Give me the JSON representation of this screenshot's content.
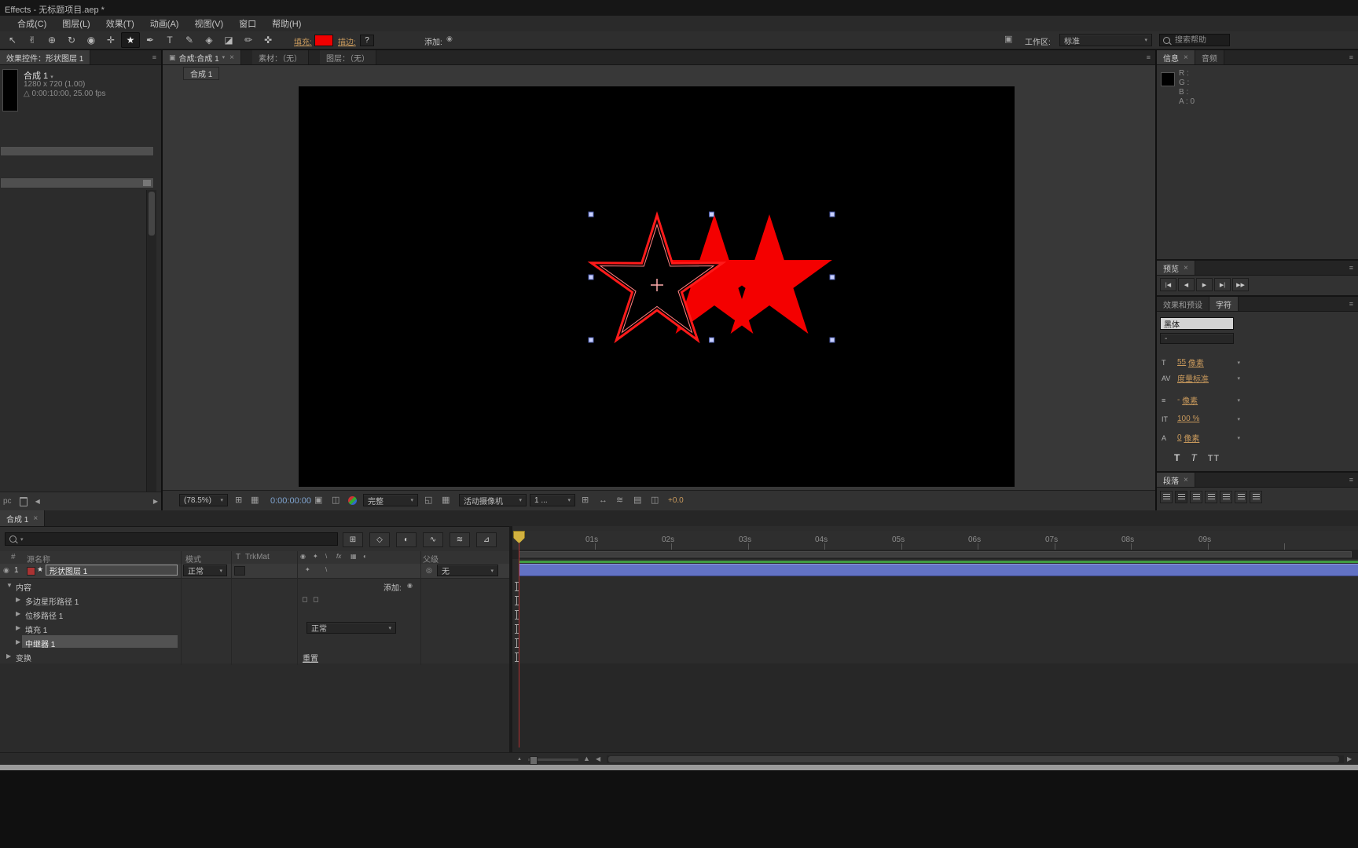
{
  "window": {
    "title": "Effects - 无标题项目.aep *"
  },
  "menu": {
    "items": [
      "合成(C)",
      "图层(L)",
      "效果(T)",
      "动画(A)",
      "视图(V)",
      "窗口",
      "帮助(H)"
    ]
  },
  "toolbar": {
    "tools": [
      {
        "name": "selection",
        "glyph": "↖"
      },
      {
        "name": "hand",
        "glyph": "✌"
      },
      {
        "name": "zoom",
        "glyph": "⊕"
      },
      {
        "name": "rotation",
        "glyph": "↻"
      },
      {
        "name": "camera",
        "glyph": "◉"
      },
      {
        "name": "pan-behind",
        "glyph": "✛"
      },
      {
        "name": "shape",
        "glyph": "★"
      },
      {
        "name": "pen",
        "glyph": "✒"
      },
      {
        "name": "text",
        "glyph": "T"
      },
      {
        "name": "brush",
        "glyph": "✎"
      },
      {
        "name": "clone-stamp",
        "glyph": "◈"
      },
      {
        "name": "eraser",
        "glyph": "◪"
      },
      {
        "name": "roto-brush",
        "glyph": "✏"
      },
      {
        "name": "puppet",
        "glyph": "✜"
      }
    ],
    "fill_label": "填充:",
    "stroke_label": "描边:",
    "stroke_value": "?",
    "add_label": "添加:",
    "workspace_label": "工作区:",
    "workspace_value": "标准",
    "search_placeholder": "搜索帮助",
    "fill_color": "#f00000"
  },
  "project_panel": {
    "tab_title": "效果控件：形状图层 1",
    "comp_name": "合成 1",
    "comp_dimensions": "1280 x 720 (1.00)",
    "comp_duration": "0:00:10:00, 25.00 fps",
    "bit_depth": "pc"
  },
  "viewer": {
    "tab_composition": "合成:合成 1",
    "tab_footage": "素材：（无）",
    "tab_layer": "图层：（无）",
    "comp_chip": "合成 1",
    "zoom_value": "(78.5%)",
    "timecode": "0:00:00:00",
    "resolution": "完整",
    "view_name": "活动摄像机",
    "view_count": "1 ...",
    "exposure": "+0.0"
  },
  "info": {
    "tab": "信息",
    "audio_tab": "音频",
    "r_label": "R :",
    "g_label": "G :",
    "b_label": "B :",
    "a_label": "A : 0"
  },
  "preview": {
    "tab": "预览"
  },
  "effects_presets": {
    "tab": "效果和预设"
  },
  "character": {
    "tab": "字符",
    "font_family": "黑体",
    "font_style": "-",
    "rows": [
      {
        "name": "font-size",
        "icon": "T",
        "value": "55",
        "unit": "像素"
      },
      {
        "name": "kerning",
        "icon": "AV",
        "value": "度量标准",
        "unit": ""
      },
      {
        "name": "tracking",
        "icon": "≡",
        "value": "-",
        "unit": "像素"
      },
      {
        "name": "vertical-scale",
        "icon": "IT",
        "value": "100 %",
        "unit": ""
      },
      {
        "name": "baseline-shift",
        "icon": "A",
        "value": "0",
        "unit": "像素"
      }
    ],
    "style_buttons": [
      "T",
      "T",
      "TT"
    ]
  },
  "paragraph": {
    "tab": "段落"
  },
  "timeline": {
    "tab": "合成 1",
    "search_placeholder": "",
    "header": {
      "hash": "#",
      "source_name": "源名称",
      "mode": "模式",
      "t": "T",
      "trkmat": "TrkMat",
      "parent": "父级"
    },
    "layer": {
      "index": "1",
      "name": "形状图层 1",
      "mode": "正常",
      "parent": "无"
    },
    "add_label": "添加:",
    "rows": [
      {
        "label": "内容"
      },
      {
        "label": "多边星形路径 1"
      },
      {
        "label": "位移路径 1"
      },
      {
        "label": "填充 1",
        "mode": "正常"
      },
      {
        "label": "中继器 1"
      },
      {
        "label": "变换",
        "reset": "重置"
      }
    ],
    "ruler_labels": [
      "01s",
      "02s",
      "03s",
      "04s",
      "05s",
      "06s",
      "07s",
      "08s",
      "09s"
    ]
  },
  "icons": {
    "panel_menu": "≡",
    "close": "×",
    "caret_down": "▾",
    "panel_tab": "▣",
    "warning_triangle": "△",
    "grid": "⊞",
    "mask_grid": "▦",
    "snapshot": "▣",
    "show_snapshot": "◫",
    "roi": "◱",
    "pixel_aspect": "↔",
    "fast_preview": "≋",
    "timeline_btn": "▤",
    "flowchart": "◫",
    "eye": "◉",
    "solo": "✦",
    "quality": "\\",
    "fx": "fx",
    "frame_blend": "▦",
    "motion_blur": "◐",
    "collapse": "✦",
    "star": "★",
    "pickwhip": "◎",
    "add_bullet": "◉",
    "mini_flowchart": "⊞",
    "draft3d": "◇",
    "shy": "◐",
    "blend_switch": "∿",
    "motion_blur_switch": "≋",
    "graph_editor": "⊿",
    "left_arrow": "◀",
    "right_arrow": "▶",
    "workspace": "▣",
    "square": "◻",
    "transport": [
      "|◀",
      "◀",
      "▶",
      "▶|",
      "▶▶"
    ]
  },
  "colors": {
    "star_red": "#ff0000",
    "layer_bar": "#6272c4",
    "cache_green": "#3f9b3f",
    "hot_text": "#c8995c",
    "selection_handle": "#c8d0ff"
  }
}
